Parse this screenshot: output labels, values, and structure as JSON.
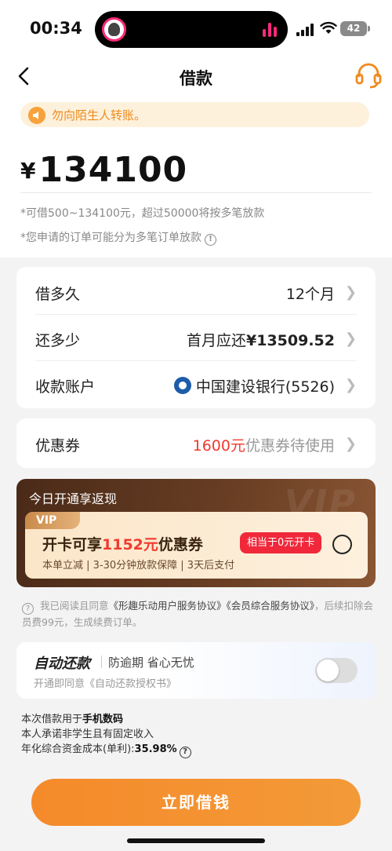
{
  "status_bar": {
    "time": "00:34",
    "battery": "42"
  },
  "header": {
    "title": "借款"
  },
  "notice": {
    "text": "勿向陌生人转账。"
  },
  "amount": {
    "symbol": "¥",
    "value": "134100"
  },
  "hints": {
    "range": "*可借500~134100元，超过50000将按多笔放款",
    "split": "*您申请的订单可能分为多笔订单放款"
  },
  "loan_info": {
    "term": {
      "label": "借多久",
      "value": "12个月"
    },
    "repay": {
      "label": "还多少",
      "prefix": "首月应还",
      "amount": "¥13509.52"
    },
    "account": {
      "label": "收款账户",
      "value": "中国建设银行(5526)"
    }
  },
  "coupon": {
    "label": "优惠券",
    "amount": "1600元",
    "suffix": "优惠券待使用"
  },
  "vip": {
    "header": "今日开通享返现",
    "watermark": "VIP",
    "tag": "VIP",
    "title_prefix": "开卡可享",
    "title_highlight": "1152元",
    "title_suffix": "优惠券",
    "subtitle": "本单立减 | 3-30分钟放款保障 | 3天后支付",
    "badge": "相当于0元开卡"
  },
  "agreement": {
    "prefix": "我已阅读且同意",
    "doc1": "《形趣乐动用户服务协议》",
    "doc2": "《会员综合服务协议》",
    "suffix": "，后续扣除会员费99元，生成续费订单。"
  },
  "auto_repay": {
    "title": "自动还款",
    "desc": "防逾期 省心无忧",
    "sub": "开通即同意《自动还款授权书》",
    "enabled": false
  },
  "footer": {
    "purpose_prefix": "本次借款用于",
    "purpose": "手机数码",
    "promise": "本人承诺非学生且有固定收入",
    "rate_prefix": "年化综合资金成本(单利):",
    "rate": "35.98%"
  },
  "cta": {
    "label": "立即借钱"
  },
  "colors": {
    "accent": "#f58a2a",
    "highlight": "#f03a2e",
    "vip_bg": "#4a2a18"
  }
}
